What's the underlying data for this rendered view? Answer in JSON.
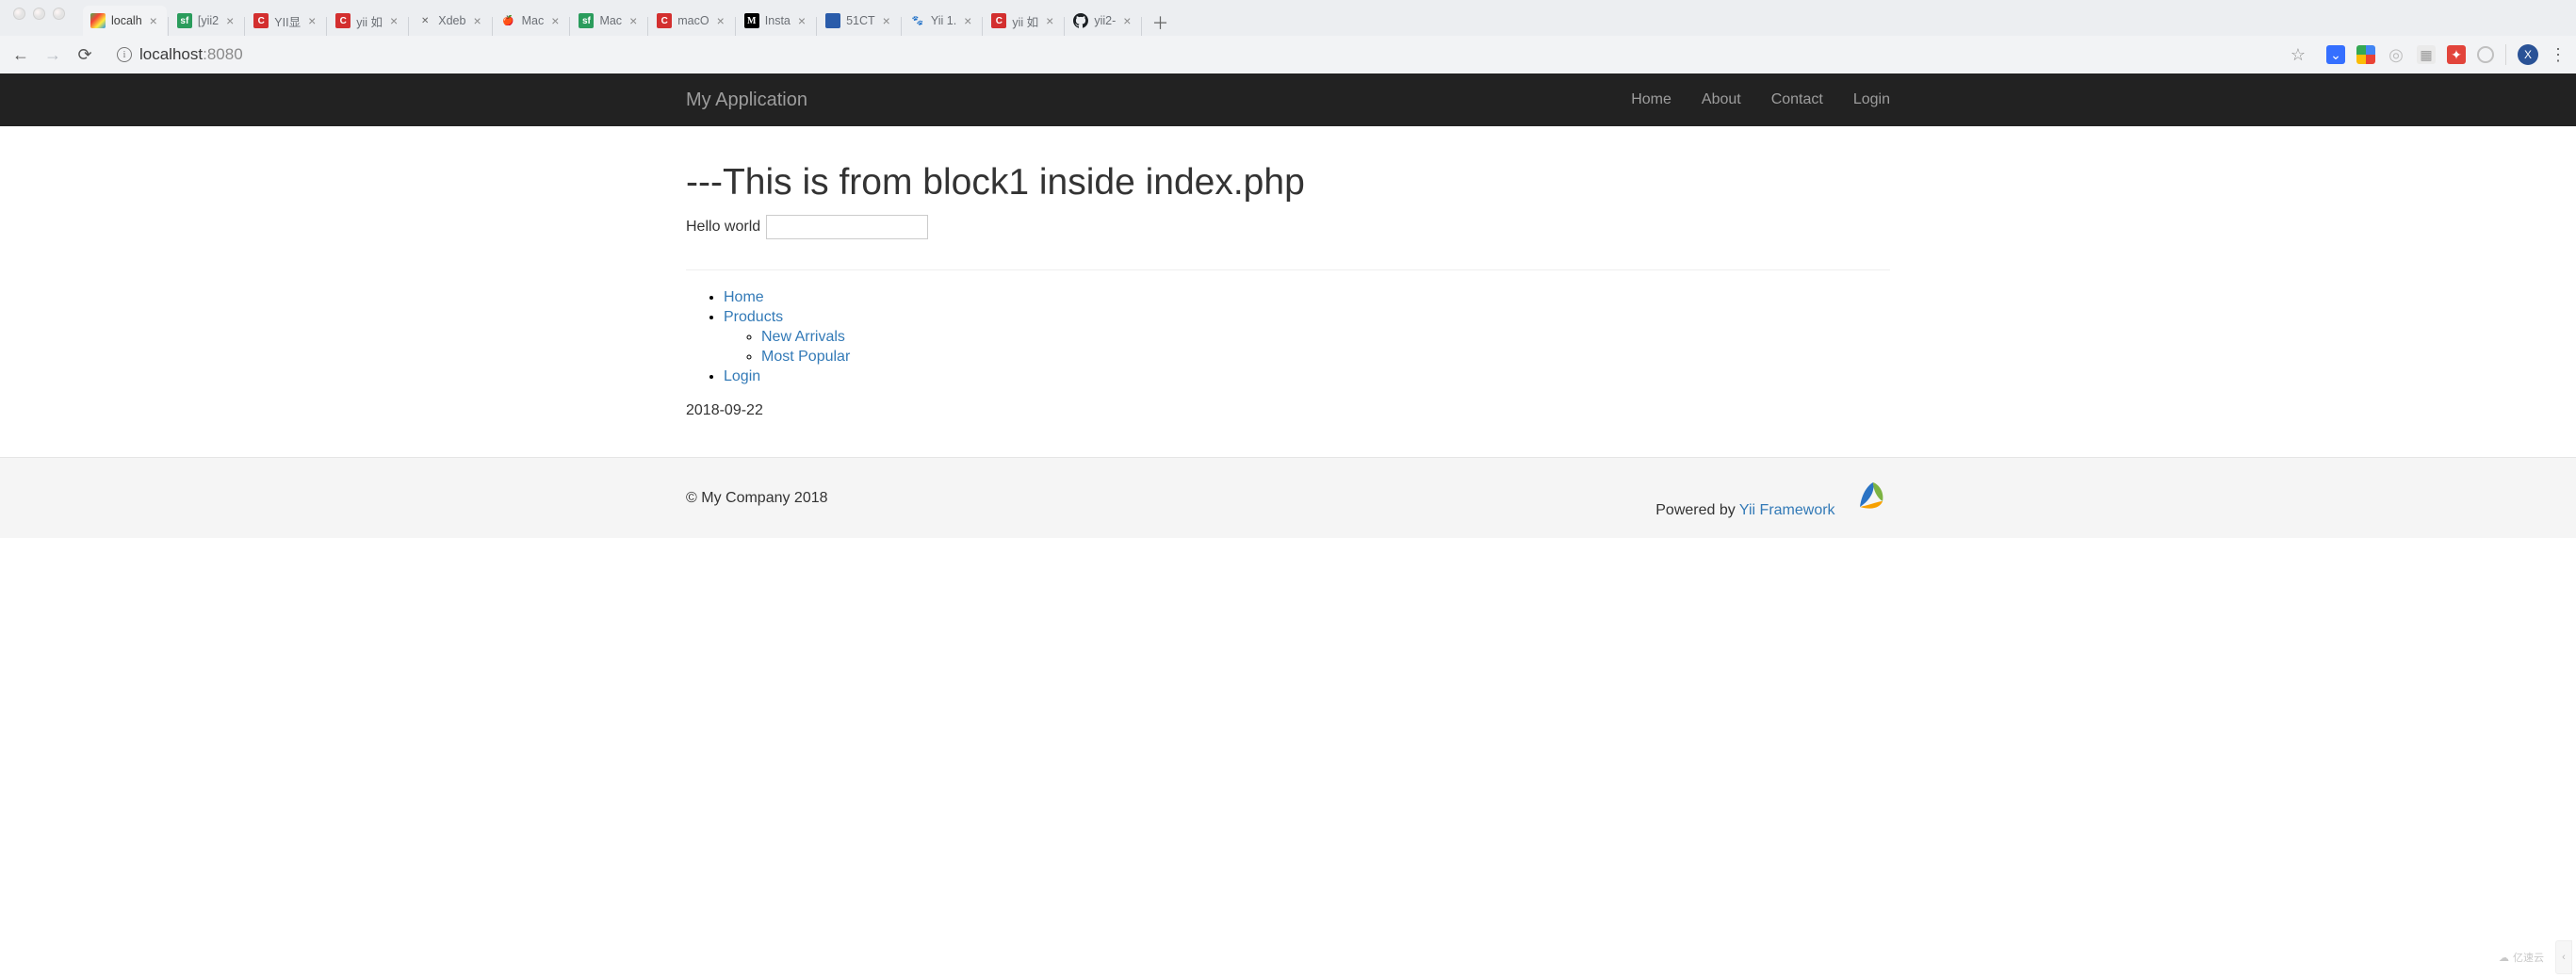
{
  "browser": {
    "tabs": [
      {
        "title": "localh",
        "favicon": "localhost",
        "active": true
      },
      {
        "title": "[yii2",
        "favicon": "sf"
      },
      {
        "title": "YII显",
        "favicon": "c"
      },
      {
        "title": "yii 如",
        "favicon": "c"
      },
      {
        "title": "Xdeb",
        "favicon": "x"
      },
      {
        "title": "Mac",
        "favicon": "mac"
      },
      {
        "title": "Mac",
        "favicon": "sf"
      },
      {
        "title": "macO",
        "favicon": "c"
      },
      {
        "title": "Insta",
        "favicon": "m"
      },
      {
        "title": "51CT",
        "favicon": "51"
      },
      {
        "title": "Yii 1.",
        "favicon": "baidu"
      },
      {
        "title": "yii 如",
        "favicon": "c"
      },
      {
        "title": "yii2-",
        "favicon": "gh"
      }
    ],
    "url": {
      "host": "localhost",
      "path": ":8080"
    }
  },
  "page": {
    "brand": "My Application",
    "nav": [
      "Home",
      "About",
      "Contact",
      "Login"
    ],
    "heading": "---This is from block1 inside index.php",
    "hello": "Hello world",
    "input_value": "",
    "menu": {
      "home": "Home",
      "products": "Products",
      "new_arrivals": "New Arrivals",
      "most_popular": "Most Popular",
      "login": "Login"
    },
    "date": "2018-09-22"
  },
  "footer": {
    "copyright": "© My Company 2018",
    "powered_prefix": "Powered by ",
    "powered_link": "Yii Framework"
  },
  "watermark": "亿速云",
  "profile_letter": "X"
}
